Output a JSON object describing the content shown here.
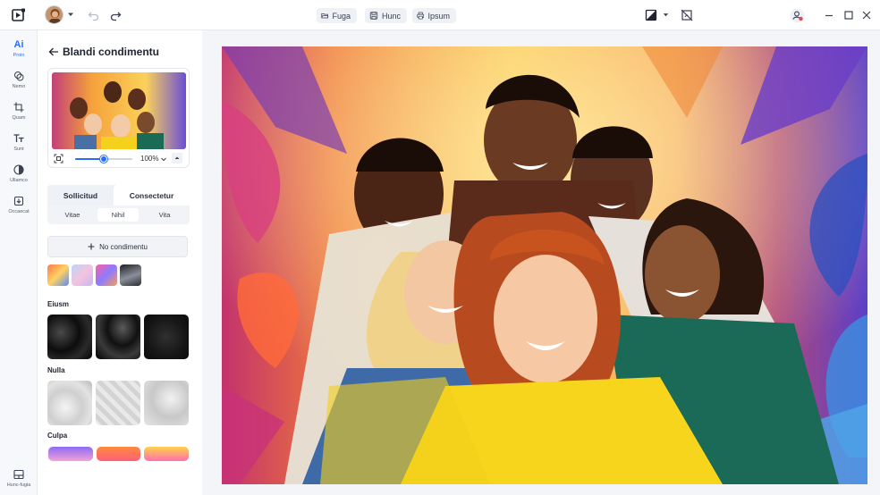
{
  "topbar": {
    "menu": [
      {
        "label": "Fuga",
        "icon": "folder-open-icon"
      },
      {
        "label": "Hunc",
        "icon": "save-icon"
      },
      {
        "label": "Ipsum",
        "icon": "printer-icon"
      }
    ]
  },
  "rail": {
    "items": [
      {
        "label": "Proin",
        "icon": "ai-icon",
        "active": true
      },
      {
        "label": "Nemo",
        "icon": "layers-icon",
        "active": false
      },
      {
        "label": "Quam",
        "icon": "crop-icon",
        "active": false
      },
      {
        "label": "Sunt",
        "icon": "text-icon",
        "active": false
      },
      {
        "label": "Ullamco",
        "icon": "contrast-icon",
        "active": false
      },
      {
        "label": "Occaecat",
        "icon": "import-icon",
        "active": false
      }
    ],
    "bottom": {
      "label": "Hunc-fugia",
      "icon": "panel-icon"
    }
  },
  "panel": {
    "title": "Blandi condimentu",
    "zoom": {
      "value": "100%",
      "slider_fraction": 0.5
    },
    "tabs": [
      {
        "label": "Sollicitud",
        "active": false
      },
      {
        "label": "Consectetur",
        "active": true
      }
    ],
    "subtabs": [
      {
        "label": "Vitae",
        "active": false
      },
      {
        "label": "Nihil",
        "active": true
      },
      {
        "label": "Vita",
        "active": false
      }
    ],
    "no_filter_label": "No condimentu",
    "sections": [
      {
        "title": "Eiusm"
      },
      {
        "title": "Nulla"
      },
      {
        "title": "Culpa"
      }
    ]
  },
  "colors": {
    "accent": "#2b6cff",
    "panel_bg": "#ffffff",
    "canvas_bg": "#f3f5f9"
  }
}
